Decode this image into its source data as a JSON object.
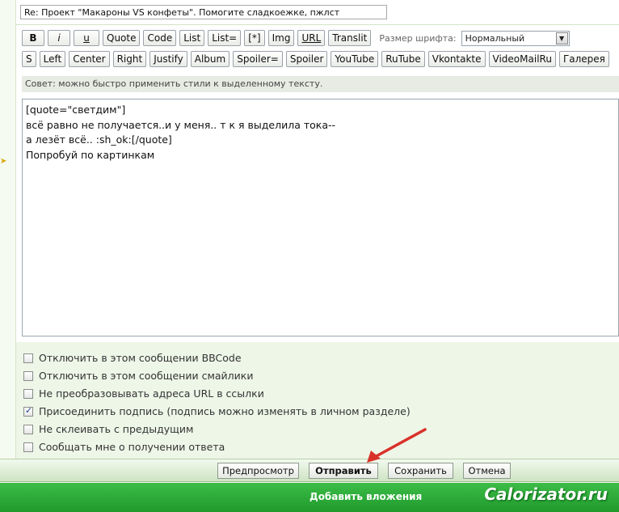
{
  "subject": {
    "value": "Re: Проект \"Макароны VS конфеты\". Помогите сладкоежке, пжлст"
  },
  "toolbar": {
    "row1": [
      "B",
      "i",
      "u",
      "Quote",
      "Code",
      "List",
      "List=",
      "[*]",
      "Img",
      "URL",
      "Translit"
    ],
    "font_size_label": "Размер шрифта:",
    "font_size_value": "Нормальный",
    "row2": [
      "S",
      "Left",
      "Center",
      "Right",
      "Justify",
      "Album",
      "Spoiler=",
      "Spoiler",
      "YouTube",
      "RuTube",
      "Vkontakte",
      "VideoMailRu",
      "Галерея"
    ]
  },
  "hint": "Совет: можно быстро применить стили к выделенному тексту.",
  "message": {
    "text": "[quote=\"светдим\"]\nвсё равно не получается..и у меня.. т к я выделила тока--\nа лезёт всё.. :sh_ok:[/quote]\nПопробуй по картинкам"
  },
  "options": [
    {
      "label": "Отключить в этом сообщении BBCode",
      "checked": false
    },
    {
      "label": "Отключить в этом сообщении смайлики",
      "checked": false
    },
    {
      "label": "Не преобразовывать адреса URL в ссылки",
      "checked": false
    },
    {
      "label": "Присоединить подпись (подпись можно изменять в личном разделе)",
      "checked": true
    },
    {
      "label": "Не склеивать с предыдущим",
      "checked": false
    },
    {
      "label": "Сообщать мне о получении ответа",
      "checked": false
    }
  ],
  "buttons": {
    "preview": "Предпросмотр",
    "submit": "Отправить",
    "save": "Сохранить",
    "cancel": "Отмена"
  },
  "attachments_bar": {
    "label": "Добавить вложения"
  },
  "watermark": "Calorizator.ru",
  "colors": {
    "accent_green": "#2aa838",
    "annotation_red": "#d9322a"
  }
}
